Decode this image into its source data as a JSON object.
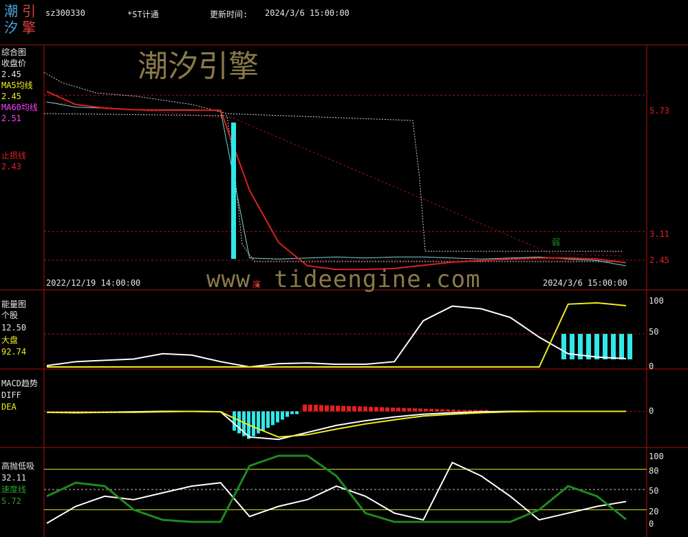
{
  "header": {
    "code": "sz300330",
    "name": "*ST计通",
    "update_label": "更新时间:",
    "update_time": "2024/3/6 15:00:00",
    "logo_chars": [
      "潮",
      "引",
      "汐",
      "擎"
    ]
  },
  "watermark": {
    "title": "潮汐引擎",
    "url_left": "www.",
    "url_right": "tideengine.com",
    "mark": "底"
  },
  "colors": {
    "background": "#000000",
    "frame": "#b01010",
    "cyan": "#30e8e8",
    "red": "#e02020",
    "yellow": "#f0f020",
    "green": "#1d7a1d",
    "white": "#ffffff",
    "magenta": "#ff40ff",
    "watermark": "#8a7a4a"
  },
  "panels": {
    "main": {
      "title": "综合图",
      "close_label": "收盘价",
      "close_value": "2.45",
      "ma5_label": "MA5均线",
      "ma5_value": "2.45",
      "ma60_label": "MA60均线",
      "ma60_value": "2.51",
      "stop_label": "止损线",
      "stop_value": "2.43",
      "right_labels": [
        "5.73",
        "3.11",
        "2.45"
      ],
      "start_date": "2022/12/19 14:00:00",
      "end_date": "2024/3/6 15:00:00",
      "weak_label": "弱"
    },
    "energy": {
      "title": "能量图",
      "stock_label": "个股",
      "stock_value": "12.50",
      "market_label": "大盘",
      "market_value": "92.74",
      "right_labels": [
        "100",
        "50",
        "0"
      ]
    },
    "macd": {
      "title": "MACD趋势",
      "diff_label": "DIFF",
      "dea_label": "DEA",
      "right_labels": [
        "0"
      ]
    },
    "oscillator": {
      "title": "高抛低吸",
      "value": "32.11",
      "speed_label": "速度线",
      "speed_value": "5.72",
      "right_labels": [
        "100",
        "80",
        "50",
        "20",
        "0"
      ]
    }
  },
  "chart_data": [
    {
      "type": "line",
      "title": "综合图",
      "x": [
        0,
        5,
        10,
        15,
        20,
        25,
        30,
        35,
        40,
        45,
        50,
        55,
        60,
        65,
        70,
        75,
        80,
        85,
        90,
        95,
        100
      ],
      "series": [
        {
          "name": "收盘价",
          "values": [
            5.6,
            5.5,
            5.48,
            5.45,
            5.45,
            5.45,
            5.43,
            2.6,
            2.58,
            2.6,
            2.62,
            2.6,
            2.62,
            2.62,
            2.6,
            2.58,
            2.6,
            2.62,
            2.58,
            2.55,
            2.45
          ]
        },
        {
          "name": "MA60均线",
          "values": [
            5.8,
            5.55,
            5.48,
            5.45,
            5.44,
            5.44,
            5.44,
            3.9,
            2.9,
            2.45,
            2.38,
            2.38,
            2.4,
            2.46,
            2.52,
            2.55,
            2.58,
            2.6,
            2.6,
            2.58,
            2.51
          ]
        }
      ],
      "ylim": [
        2.2,
        6.5
      ]
    },
    {
      "type": "line",
      "title": "能量图",
      "x": [
        0,
        5,
        10,
        15,
        20,
        25,
        30,
        35,
        40,
        45,
        50,
        55,
        60,
        65,
        70,
        75,
        80,
        85,
        90,
        95,
        100
      ],
      "series": [
        {
          "name": "个股",
          "values": [
            2,
            8,
            10,
            12,
            20,
            18,
            8,
            0,
            5,
            6,
            4,
            4,
            8,
            70,
            92,
            88,
            75,
            45,
            20,
            15,
            12.5
          ]
        },
        {
          "name": "大盘",
          "values": [
            0,
            0,
            0,
            0,
            0,
            0,
            0,
            0,
            0,
            0,
            0,
            0,
            0,
            0,
            0,
            0,
            0,
            0,
            95,
            97,
            92.74
          ]
        }
      ],
      "ylim": [
        0,
        100
      ]
    },
    {
      "type": "line",
      "title": "MACD趋势",
      "x": [
        0,
        5,
        10,
        15,
        20,
        25,
        30,
        35,
        40,
        45,
        50,
        55,
        60,
        65,
        70,
        75,
        80,
        85,
        90,
        95,
        100
      ],
      "series": [
        {
          "name": "DIFF",
          "values": [
            -0.02,
            -0.03,
            -0.02,
            -0.01,
            0,
            0,
            -0.01,
            -0.55,
            -0.6,
            -0.45,
            -0.3,
            -0.2,
            -0.12,
            -0.06,
            -0.03,
            -0.01,
            0,
            0,
            0,
            0,
            0
          ]
        },
        {
          "name": "DEA",
          "values": [
            -0.02,
            -0.02,
            -0.02,
            -0.02,
            -0.01,
            0,
            -0.01,
            -0.3,
            -0.55,
            -0.5,
            -0.38,
            -0.27,
            -0.18,
            -0.1,
            -0.06,
            -0.03,
            -0.01,
            0,
            0,
            0,
            0
          ]
        }
      ],
      "ylim": [
        -0.7,
        0.7
      ]
    },
    {
      "type": "line",
      "title": "高抛低吸",
      "x": [
        0,
        5,
        10,
        15,
        20,
        25,
        30,
        35,
        40,
        45,
        50,
        55,
        60,
        65,
        70,
        75,
        80,
        85,
        90,
        95,
        100
      ],
      "series": [
        {
          "name": "高抛低吸",
          "values": [
            0,
            25,
            40,
            35,
            45,
            55,
            60,
            10,
            25,
            35,
            55,
            40,
            15,
            5,
            90,
            70,
            40,
            5,
            15,
            25,
            32.11
          ]
        },
        {
          "name": "速度线",
          "values": [
            40,
            60,
            55,
            20,
            5,
            2,
            2,
            85,
            100,
            100,
            70,
            15,
            2,
            2,
            2,
            2,
            2,
            20,
            55,
            40,
            5.72
          ]
        }
      ],
      "ylim": [
        0,
        100
      ]
    }
  ]
}
